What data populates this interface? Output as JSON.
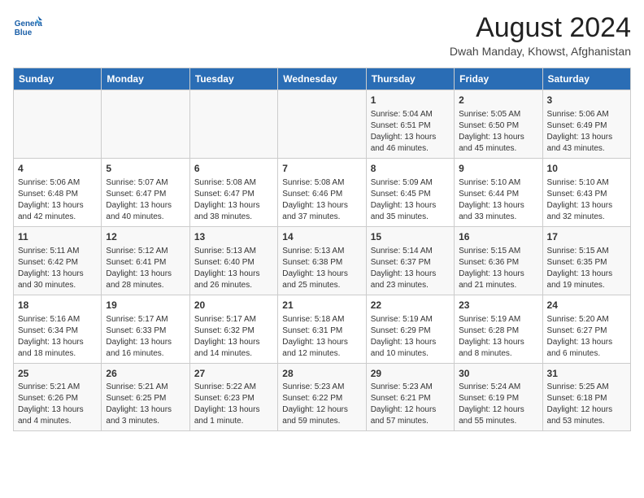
{
  "header": {
    "logo_line1": "General",
    "logo_line2": "Blue",
    "title": "August 2024",
    "subtitle": "Dwah Manday, Khowst, Afghanistan"
  },
  "days_of_week": [
    "Sunday",
    "Monday",
    "Tuesday",
    "Wednesday",
    "Thursday",
    "Friday",
    "Saturday"
  ],
  "weeks": [
    [
      {
        "day": "",
        "info": ""
      },
      {
        "day": "",
        "info": ""
      },
      {
        "day": "",
        "info": ""
      },
      {
        "day": "",
        "info": ""
      },
      {
        "day": "1",
        "info": "Sunrise: 5:04 AM\nSunset: 6:51 PM\nDaylight: 13 hours\nand 46 minutes."
      },
      {
        "day": "2",
        "info": "Sunrise: 5:05 AM\nSunset: 6:50 PM\nDaylight: 13 hours\nand 45 minutes."
      },
      {
        "day": "3",
        "info": "Sunrise: 5:06 AM\nSunset: 6:49 PM\nDaylight: 13 hours\nand 43 minutes."
      }
    ],
    [
      {
        "day": "4",
        "info": "Sunrise: 5:06 AM\nSunset: 6:48 PM\nDaylight: 13 hours\nand 42 minutes."
      },
      {
        "day": "5",
        "info": "Sunrise: 5:07 AM\nSunset: 6:47 PM\nDaylight: 13 hours\nand 40 minutes."
      },
      {
        "day": "6",
        "info": "Sunrise: 5:08 AM\nSunset: 6:47 PM\nDaylight: 13 hours\nand 38 minutes."
      },
      {
        "day": "7",
        "info": "Sunrise: 5:08 AM\nSunset: 6:46 PM\nDaylight: 13 hours\nand 37 minutes."
      },
      {
        "day": "8",
        "info": "Sunrise: 5:09 AM\nSunset: 6:45 PM\nDaylight: 13 hours\nand 35 minutes."
      },
      {
        "day": "9",
        "info": "Sunrise: 5:10 AM\nSunset: 6:44 PM\nDaylight: 13 hours\nand 33 minutes."
      },
      {
        "day": "10",
        "info": "Sunrise: 5:10 AM\nSunset: 6:43 PM\nDaylight: 13 hours\nand 32 minutes."
      }
    ],
    [
      {
        "day": "11",
        "info": "Sunrise: 5:11 AM\nSunset: 6:42 PM\nDaylight: 13 hours\nand 30 minutes."
      },
      {
        "day": "12",
        "info": "Sunrise: 5:12 AM\nSunset: 6:41 PM\nDaylight: 13 hours\nand 28 minutes."
      },
      {
        "day": "13",
        "info": "Sunrise: 5:13 AM\nSunset: 6:40 PM\nDaylight: 13 hours\nand 26 minutes."
      },
      {
        "day": "14",
        "info": "Sunrise: 5:13 AM\nSunset: 6:38 PM\nDaylight: 13 hours\nand 25 minutes."
      },
      {
        "day": "15",
        "info": "Sunrise: 5:14 AM\nSunset: 6:37 PM\nDaylight: 13 hours\nand 23 minutes."
      },
      {
        "day": "16",
        "info": "Sunrise: 5:15 AM\nSunset: 6:36 PM\nDaylight: 13 hours\nand 21 minutes."
      },
      {
        "day": "17",
        "info": "Sunrise: 5:15 AM\nSunset: 6:35 PM\nDaylight: 13 hours\nand 19 minutes."
      }
    ],
    [
      {
        "day": "18",
        "info": "Sunrise: 5:16 AM\nSunset: 6:34 PM\nDaylight: 13 hours\nand 18 minutes."
      },
      {
        "day": "19",
        "info": "Sunrise: 5:17 AM\nSunset: 6:33 PM\nDaylight: 13 hours\nand 16 minutes."
      },
      {
        "day": "20",
        "info": "Sunrise: 5:17 AM\nSunset: 6:32 PM\nDaylight: 13 hours\nand 14 minutes."
      },
      {
        "day": "21",
        "info": "Sunrise: 5:18 AM\nSunset: 6:31 PM\nDaylight: 13 hours\nand 12 minutes."
      },
      {
        "day": "22",
        "info": "Sunrise: 5:19 AM\nSunset: 6:29 PM\nDaylight: 13 hours\nand 10 minutes."
      },
      {
        "day": "23",
        "info": "Sunrise: 5:19 AM\nSunset: 6:28 PM\nDaylight: 13 hours\nand 8 minutes."
      },
      {
        "day": "24",
        "info": "Sunrise: 5:20 AM\nSunset: 6:27 PM\nDaylight: 13 hours\nand 6 minutes."
      }
    ],
    [
      {
        "day": "25",
        "info": "Sunrise: 5:21 AM\nSunset: 6:26 PM\nDaylight: 13 hours\nand 4 minutes."
      },
      {
        "day": "26",
        "info": "Sunrise: 5:21 AM\nSunset: 6:25 PM\nDaylight: 13 hours\nand 3 minutes."
      },
      {
        "day": "27",
        "info": "Sunrise: 5:22 AM\nSunset: 6:23 PM\nDaylight: 13 hours\nand 1 minute."
      },
      {
        "day": "28",
        "info": "Sunrise: 5:23 AM\nSunset: 6:22 PM\nDaylight: 12 hours\nand 59 minutes."
      },
      {
        "day": "29",
        "info": "Sunrise: 5:23 AM\nSunset: 6:21 PM\nDaylight: 12 hours\nand 57 minutes."
      },
      {
        "day": "30",
        "info": "Sunrise: 5:24 AM\nSunset: 6:19 PM\nDaylight: 12 hours\nand 55 minutes."
      },
      {
        "day": "31",
        "info": "Sunrise: 5:25 AM\nSunset: 6:18 PM\nDaylight: 12 hours\nand 53 minutes."
      }
    ]
  ]
}
